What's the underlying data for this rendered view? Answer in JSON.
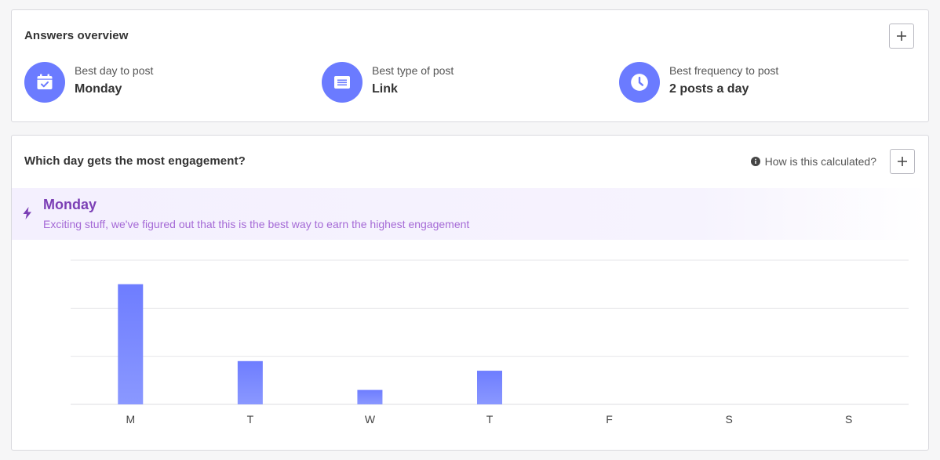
{
  "overview": {
    "title": "Answers overview",
    "stats": [
      {
        "label": "Best day to post",
        "value": "Monday",
        "icon": "calendar-check-icon"
      },
      {
        "label": "Best type of post",
        "value": "Link",
        "icon": "post-list-icon"
      },
      {
        "label": "Best frequency to post",
        "value": "2 posts a day",
        "icon": "clock-icon"
      }
    ]
  },
  "engagement": {
    "title": "Which day gets the most engagement?",
    "info_link": "How is this calculated?",
    "banner": {
      "title": "Monday",
      "subtitle": "Exciting stuff, we've figured out that this is the best way to earn the highest engagement"
    }
  },
  "colors": {
    "accent": "#6b7bff",
    "banner_title": "#7b3fb5",
    "banner_subtitle": "#a56ad6",
    "bar_top": "#6e7dff",
    "bar_bottom": "#8a98ff"
  },
  "chart_data": {
    "type": "bar",
    "categories": [
      "M",
      "T",
      "W",
      "T",
      "F",
      "S",
      "S"
    ],
    "values": [
      2.5,
      0.9,
      0.3,
      0.7,
      0,
      0,
      0
    ],
    "ylim": [
      0,
      3
    ],
    "grid": true,
    "xlabel": "",
    "ylabel": ""
  }
}
